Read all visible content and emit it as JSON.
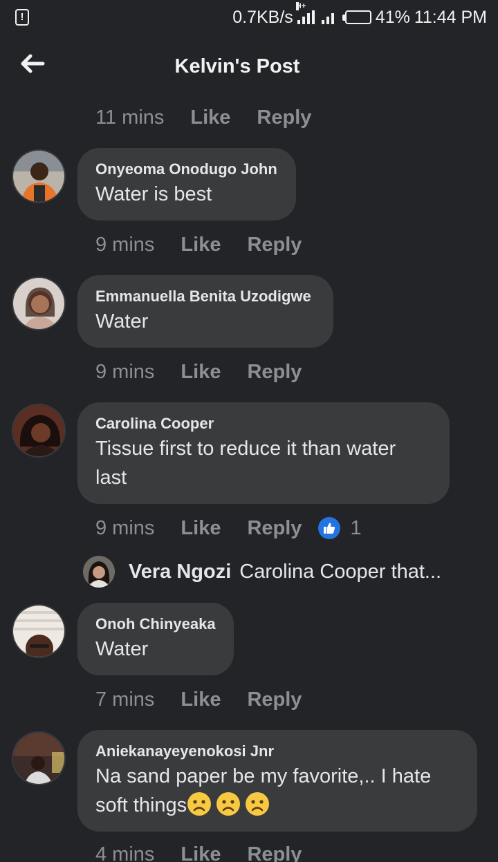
{
  "status_bar": {
    "alert_icon": "!",
    "net_speed": "0.7KB/s",
    "network_type": "H+",
    "battery_level": 0.41,
    "battery_text": "41%",
    "time": "11:44 PM"
  },
  "header": {
    "title": "Kelvin's Post",
    "back_icon": "arrow-left-icon"
  },
  "top_meta": {
    "time": "11 mins",
    "like": "Like",
    "reply": "Reply"
  },
  "comments": [
    {
      "author": "Onyeoma Onodugo John",
      "text": "Water is best",
      "time": "9 mins",
      "like": "Like",
      "reply": "Reply"
    },
    {
      "author": "Emmanuella Benita Uzodigwe",
      "text": "Water",
      "time": "9 mins",
      "like": "Like",
      "reply": "Reply"
    },
    {
      "author": "Carolina Cooper",
      "text": "Tissue first to reduce it than water last",
      "time": "9 mins",
      "like": "Like",
      "reply": "Reply",
      "reaction_icon": "like-reaction-icon",
      "reaction_count": "1",
      "reply_preview": {
        "author": "Vera Ngozi",
        "text": "Carolina Cooper that..."
      }
    },
    {
      "author": "Onoh Chinyeaka",
      "text": "Water",
      "time": "7 mins",
      "like": "Like",
      "reply": "Reply"
    },
    {
      "author": "Aniekanayeyenokosi Jnr",
      "text": "Na sand paper be my favorite,.. I hate soft things",
      "emoji": [
        "frowning-face-emoji",
        "frowning-face-emoji",
        "frowning-face-emoji"
      ],
      "time": "4 mins",
      "like": "Like",
      "reply": "Reply"
    }
  ],
  "colors": {
    "background": "#232427",
    "bubble": "#3a3b3c",
    "text_primary": "#e4e6eb",
    "text_secondary": "#8c8f94",
    "like_blue": "#2374e1"
  }
}
